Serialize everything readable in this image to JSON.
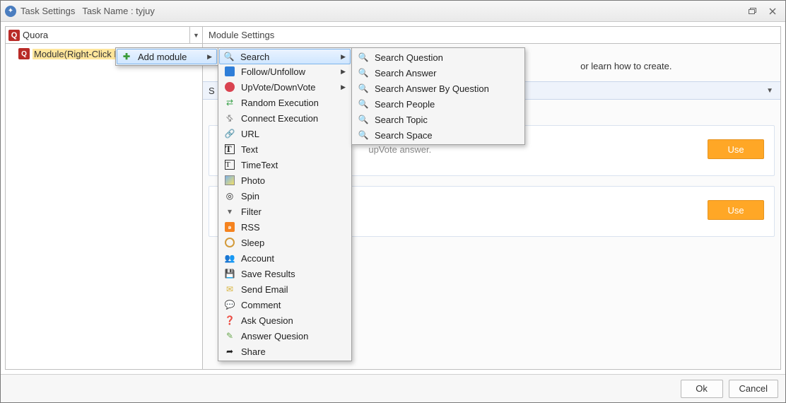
{
  "titlebar": {
    "title": "Task Settings",
    "task_name_label": "Task Name : tyjuy"
  },
  "left": {
    "combo_value": "Quora",
    "tree_node_label": "Module(Right-Click Here)"
  },
  "right": {
    "header": "Module Settings",
    "hint_fragment": "or learn how to create.",
    "section_label_fragment": "S",
    "card1_text_fragment": "upVote answer.",
    "use_label": "Use"
  },
  "footer": {
    "ok": "Ok",
    "cancel": "Cancel"
  },
  "menu1": {
    "add_module": "Add module"
  },
  "menu2": {
    "items": [
      {
        "label": "Search",
        "arrow": true,
        "icon": "mag",
        "hl": true
      },
      {
        "label": "Follow/Unfollow",
        "arrow": true,
        "icon": "follow"
      },
      {
        "label": "UpVote/DownVote",
        "arrow": true,
        "icon": "red"
      },
      {
        "label": "Random Execution",
        "icon": "shuffle"
      },
      {
        "label": "Connect Execution",
        "icon": "link2"
      },
      {
        "label": "URL",
        "icon": "link"
      },
      {
        "label": "Text",
        "icon": "T"
      },
      {
        "label": "TimeText",
        "icon": "Tt"
      },
      {
        "label": "Photo",
        "icon": "photo"
      },
      {
        "label": "Spin",
        "icon": "spin"
      },
      {
        "label": "Filter",
        "icon": "filter"
      },
      {
        "label": "RSS",
        "icon": "rss"
      },
      {
        "label": "Sleep",
        "icon": "sleep"
      },
      {
        "label": "Account",
        "icon": "acct"
      },
      {
        "label": "Save Results",
        "icon": "save"
      },
      {
        "label": "Send Email",
        "icon": "mail"
      },
      {
        "label": "Comment",
        "icon": "comment"
      },
      {
        "label": "Ask Quesion",
        "icon": "ask"
      },
      {
        "label": "Answer Quesion",
        "icon": "ans"
      },
      {
        "label": "Share",
        "icon": "share"
      }
    ]
  },
  "menu3": {
    "items": [
      {
        "label": "Search Question"
      },
      {
        "label": "Search Answer"
      },
      {
        "label": "Search Answer By Question"
      },
      {
        "label": "Search People"
      },
      {
        "label": "Search Topic"
      },
      {
        "label": "Search Space"
      }
    ]
  }
}
